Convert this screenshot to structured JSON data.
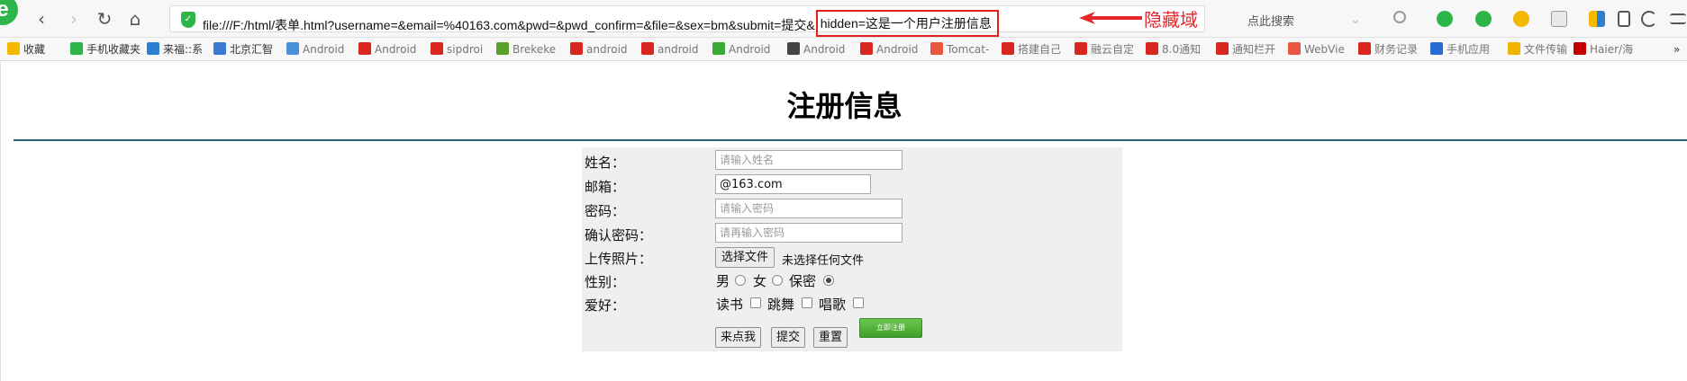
{
  "toolbar": {
    "logo_letter": "e",
    "back_glyph": "‹",
    "forward_glyph": "›",
    "reload_glyph": "↻",
    "home_glyph": "⌂",
    "url_main": "file:///F:/html/表单.html?username=&email=%40163.com&pwd=&pwd_confirm=&file=&sex=bm&submit=提交&",
    "url_highlight": "hidden=这是一个用户注册信息",
    "annotation": "隐藏域",
    "annotation_color": "#e6262d",
    "search_placeholder": "点此搜索"
  },
  "bookmarks": [
    {
      "label": "收藏",
      "icon": "star-icon",
      "color": "#f5b800"
    },
    {
      "label": "手机收藏夹",
      "icon": "phone-icon",
      "color": "#2eb54a"
    },
    {
      "label": "来福::系",
      "icon": "globe-icon",
      "color": "#2a7fd4"
    },
    {
      "label": "北京汇智",
      "icon": "page-icon",
      "color": "#3a7bd5"
    },
    {
      "label": "Android",
      "icon": "layers-icon",
      "color": "#4a90d9"
    },
    {
      "label": "Android",
      "icon": "csdn-icon",
      "color": "#d9271f"
    },
    {
      "label": "sipdroi",
      "icon": "csdn-icon",
      "color": "#d9271f"
    },
    {
      "label": "Brekeke",
      "icon": "leaf-icon",
      "color": "#5aa02c"
    },
    {
      "label": "android",
      "icon": "csdn-icon",
      "color": "#d9271f"
    },
    {
      "label": "android",
      "icon": "csdn-icon",
      "color": "#d9271f"
    },
    {
      "label": "Android",
      "icon": "clover-icon",
      "color": "#3aa935"
    },
    {
      "label": "Android",
      "icon": "feather-icon",
      "color": "#444444"
    },
    {
      "label": "Android",
      "icon": "csdn-icon",
      "color": "#d9271f"
    },
    {
      "label": "Tomcat-",
      "icon": "jianshu-icon",
      "color": "#e8563f"
    },
    {
      "label": "搭建自己",
      "icon": "csdn-icon",
      "color": "#d9271f"
    },
    {
      "label": "融云自定",
      "icon": "csdn-icon",
      "color": "#d9271f"
    },
    {
      "label": "8.0通知",
      "icon": "csdn-icon",
      "color": "#d9271f"
    },
    {
      "label": "通知栏开",
      "icon": "csdn-icon",
      "color": "#d9271f"
    },
    {
      "label": "WebVie",
      "icon": "jianshu-icon",
      "color": "#e8563f"
    },
    {
      "label": "财务记录",
      "icon": "finance-icon",
      "color": "#d9271f"
    },
    {
      "label": "手机应用",
      "icon": "paw-icon",
      "color": "#2a6ad4"
    },
    {
      "label": "文件传输",
      "icon": "f-icon",
      "color": "#f0b400"
    },
    {
      "label": "Haier/海",
      "icon": "tmall-icon",
      "color": "#c40000"
    }
  ],
  "bookmarks_more": "»",
  "page": {
    "title": "注册信息",
    "fields": {
      "name_label": "姓名：",
      "name_placeholder": "请输入姓名",
      "email_label": "邮箱：",
      "email_value": "@163.com",
      "pwd_label": "密码：",
      "pwd_placeholder": "请输入密码",
      "confirm_label": "确认密码：",
      "confirm_placeholder": "请再输入密码",
      "upload_label": "上传照片：",
      "file_button": "选择文件",
      "file_status": "未选择任何文件",
      "gender_label": "性别：",
      "gender_options": [
        "男",
        "女",
        "保密"
      ],
      "gender_selected": "保密",
      "hobby_label": "爱好：",
      "hobby_options": [
        "读书",
        "跳舞",
        "唱歌"
      ],
      "image_button": "立即注册",
      "button_click": "来点我",
      "button_submit": "提交",
      "button_reset": "重置"
    }
  }
}
